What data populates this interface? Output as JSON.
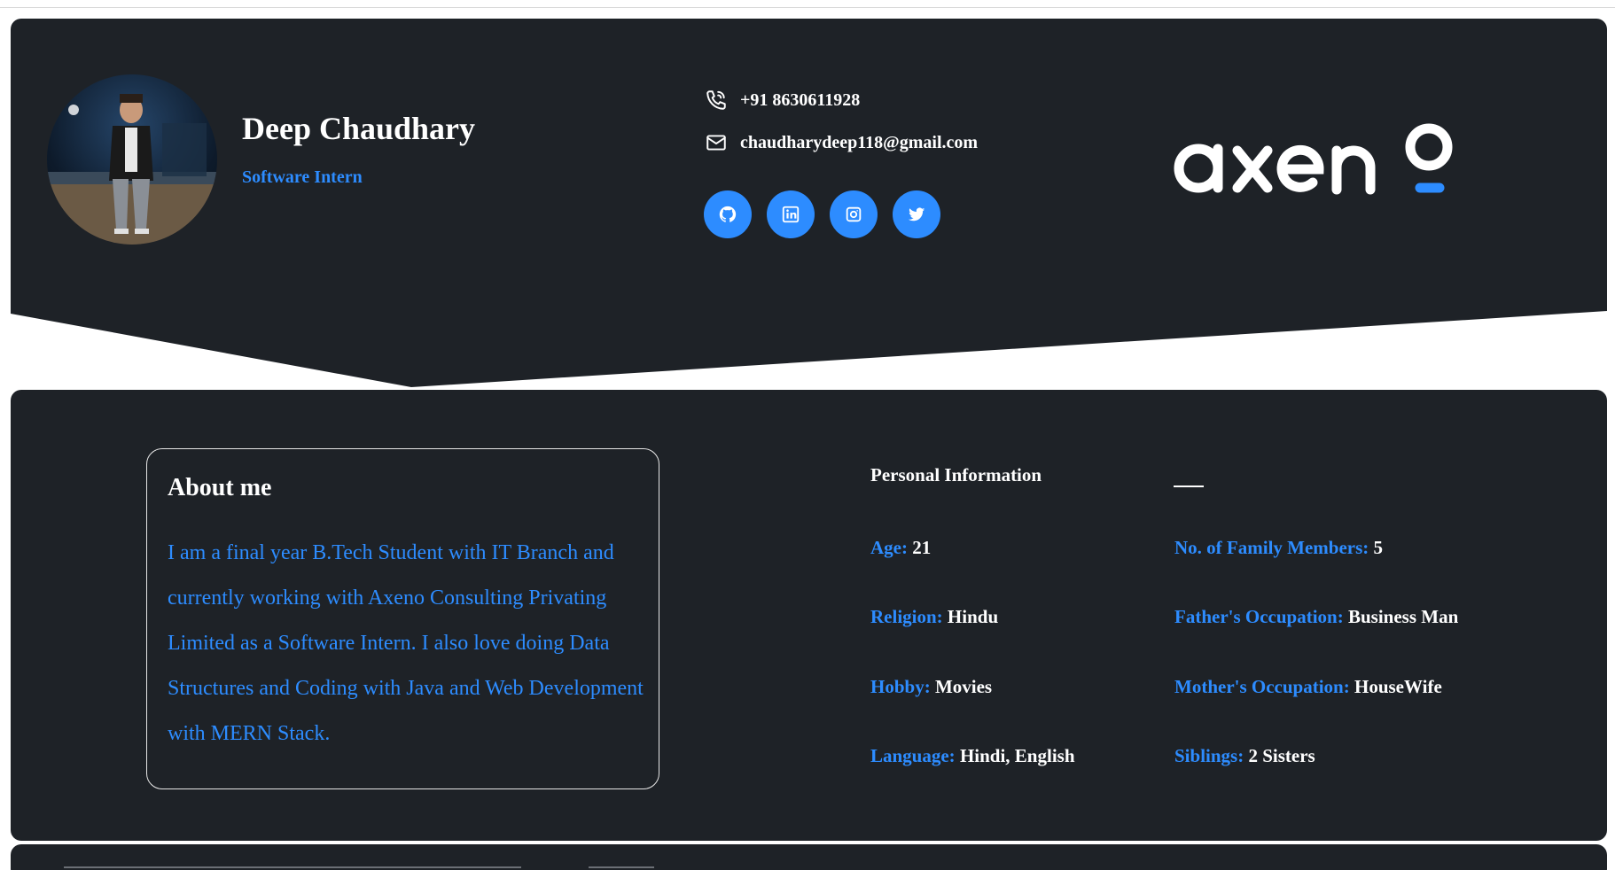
{
  "profile": {
    "name": "Deep Chaudhary",
    "role": "Software Intern",
    "avatar_alt": "profile-photo"
  },
  "contact": {
    "phone": "+91 8630611928",
    "email": "chaudharydeep118@gmail.com",
    "phone_icon": "phone-icon",
    "email_icon": "mail-icon"
  },
  "socials": [
    {
      "name": "github",
      "icon": "github-icon"
    },
    {
      "name": "linkedin",
      "icon": "linkedin-icon"
    },
    {
      "name": "instagram",
      "icon": "instagram-icon"
    },
    {
      "name": "twitter",
      "icon": "twitter-icon"
    }
  ],
  "brand": {
    "logo_text": "axeno"
  },
  "about": {
    "title": "About me",
    "text": "I am a final year B.Tech Student with IT Branch and currently working with Axeno Consulting Privating Limited as a Software Intern. I also love doing Data Structures and Coding with Java and Web Development with MERN Stack."
  },
  "personal_info": {
    "title": "Personal Information",
    "left": [
      {
        "label": "Age:",
        "value": "21"
      },
      {
        "label": "Religion:",
        "value": "Hindu"
      },
      {
        "label": "Hobby:",
        "value": "Movies"
      },
      {
        "label": "Language:",
        "value": "Hindi, English"
      }
    ],
    "right": [
      {
        "label": "No. of Family Members:",
        "value": "5"
      },
      {
        "label": "Father's Occupation:",
        "value": "Business Man"
      },
      {
        "label": "Mother's Occupation:",
        "value": "HouseWife"
      },
      {
        "label": "Siblings:",
        "value": "2 Sisters"
      }
    ]
  },
  "colors": {
    "background": "#1e2227",
    "accent": "#2d8cff",
    "text": "#ffffff"
  }
}
